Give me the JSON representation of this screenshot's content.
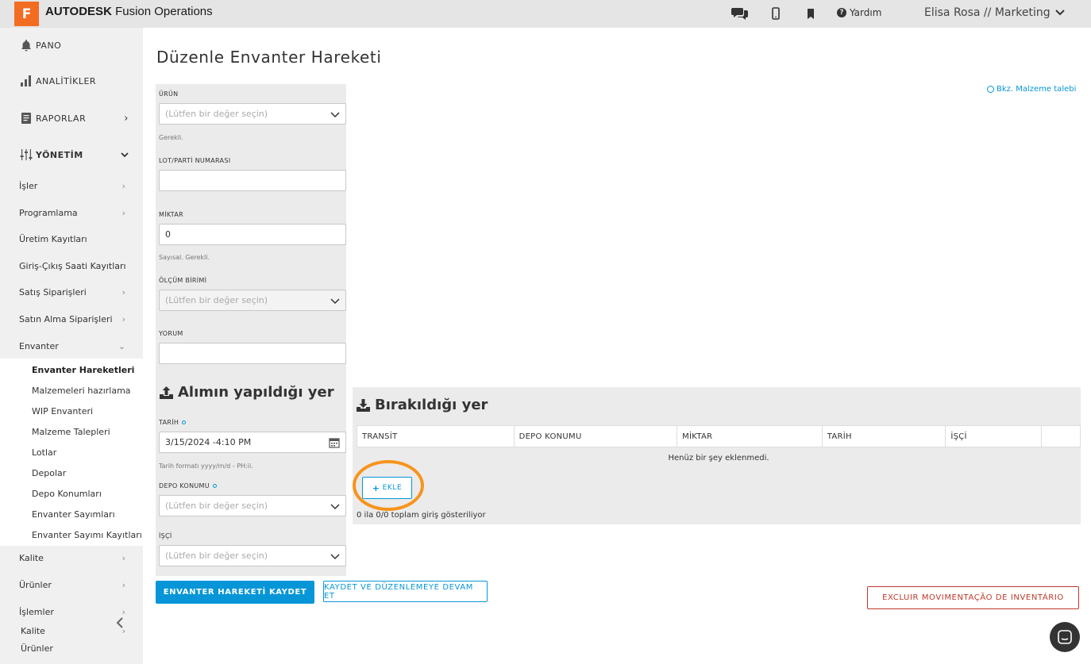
{
  "topbar": {
    "logo_letter": "F",
    "brand_bold": "AUTODESK",
    "brand_rest": " Fusion Operations",
    "help_label": "Yardım",
    "user_label": "Elisa Rosa // Marketing"
  },
  "sidebar": {
    "main": [
      {
        "label": "PANO"
      },
      {
        "label": "ANALİTİKLER"
      },
      {
        "label": "RAPORLAR"
      },
      {
        "label": "YÖNETİM"
      }
    ],
    "sub": [
      {
        "label": "İşler"
      },
      {
        "label": "Programlama"
      },
      {
        "label": "Üretim Kayıtları"
      },
      {
        "label": "Giriş-Çıkış Saati Kayıtları"
      },
      {
        "label": "Satış Siparişleri"
      },
      {
        "label": "Satın Alma Siparişleri"
      },
      {
        "label": "Envanter"
      }
    ],
    "inventory": [
      {
        "label": "Envanter Hareketleri"
      },
      {
        "label": "Malzemeleri hazırlama"
      },
      {
        "label": "WIP Envanteri"
      },
      {
        "label": "Malzeme Talepleri"
      },
      {
        "label": "Lotlar"
      },
      {
        "label": "Depolar"
      },
      {
        "label": "Depo Konumları"
      },
      {
        "label": "Envanter Sayımları"
      },
      {
        "label": "Envanter Sayımı Kayıtları"
      }
    ],
    "bottom": [
      {
        "label": "Kalite"
      },
      {
        "label": "Ürünler"
      },
      {
        "label": "İşlemler"
      },
      {
        "label": "Kalite"
      },
      {
        "label": "Ürünler"
      }
    ]
  },
  "page": {
    "title": "Düzenle Envanter Hareketi",
    "request_link": "Bkz. Malzeme talebi"
  },
  "form": {
    "product_label": "ÜRÜN",
    "product_placeholder": "(Lütfen bir değer seçin)",
    "product_hint": "Gerekli.",
    "lot_label": "LOT/PARTİ NUMARASI",
    "lot_value": "",
    "qty_label": "MİKTAR",
    "qty_value": "0",
    "qty_hint": "Sayısal. Gerekli.",
    "unit_label": "ÖLÇÜM BİRİMİ",
    "unit_placeholder": "(Lütfen bir değer seçin)",
    "comment_label": "YORUM",
    "comment_value": ""
  },
  "receive": {
    "heading": "Alımın yapıldığı yer",
    "date_label": "TARİH",
    "date_value": "3/15/2024 -4:10 PM",
    "date_hint": "Tarih formatı yyyy/m/d - PH:ii.",
    "location_label": "DEPO KONUMU",
    "location_placeholder": "(Lütfen bir değer seçin)",
    "worker_label": "İŞÇİ",
    "worker_placeholder": "(Lütfen bir değer seçin)"
  },
  "drop": {
    "heading": "Bırakıldığı yer",
    "columns": [
      "TRANSİT",
      "DEPO KONUMU",
      "MİKTAR",
      "TARİH",
      "İŞÇİ"
    ],
    "empty_message": "Henüz bir şey eklenmedi.",
    "add_label": "EKLE",
    "count_info": "0 ila 0/0 toplam giriş gösteriliyor"
  },
  "actions": {
    "save": "ENVANTER HAREKETİ KAYDET",
    "save_continue": "KAYDET VE DÜZENLEMEYE DEVAM ET",
    "delete": "EXCLUIR MOVIMENTAÇÃO DE INVENTÁRIO"
  },
  "colors": {
    "accent": "#0696d7",
    "brand": "#f26c22",
    "danger": "#c0392b",
    "highlight": "#f7941d"
  }
}
